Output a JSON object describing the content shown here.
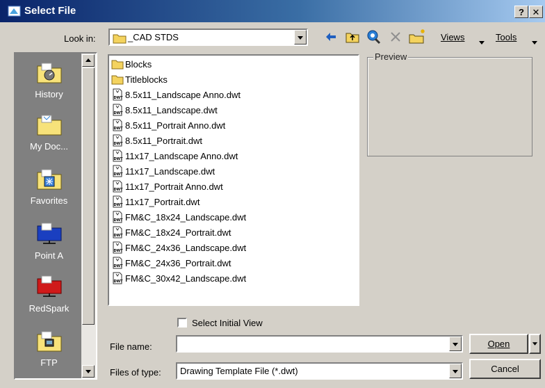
{
  "window": {
    "title": "Select File",
    "help_glyph": "?",
    "close_glyph": "✕"
  },
  "lookin": {
    "label": "Look in:",
    "value": "_CAD STDS"
  },
  "toolbar": {
    "views_label": "Views",
    "tools_label": "Tools"
  },
  "places": [
    {
      "label": "History",
      "icon": "history-folder-icon"
    },
    {
      "label": "My Doc...",
      "icon": "my-documents-folder-icon"
    },
    {
      "label": "Favorites",
      "icon": "favorites-folder-icon"
    },
    {
      "label": "Point A",
      "icon": "network-folder-icon"
    },
    {
      "label": "RedSpark",
      "icon": "network-folder-red-icon"
    },
    {
      "label": "FTP",
      "icon": "ftp-folder-icon"
    }
  ],
  "files": [
    {
      "name": "Blocks",
      "type": "folder"
    },
    {
      "name": "Titleblocks",
      "type": "folder"
    },
    {
      "name": "8.5x11_Landscape Anno.dwt",
      "type": "dwt"
    },
    {
      "name": "8.5x11_Landscape.dwt",
      "type": "dwt"
    },
    {
      "name": "8.5x11_Portrait Anno.dwt",
      "type": "dwt"
    },
    {
      "name": "8.5x11_Portrait.dwt",
      "type": "dwt"
    },
    {
      "name": "11x17_Landscape Anno.dwt",
      "type": "dwt"
    },
    {
      "name": "11x17_Landscape.dwt",
      "type": "dwt"
    },
    {
      "name": "11x17_Portrait Anno.dwt",
      "type": "dwt"
    },
    {
      "name": "11x17_Portrait.dwt",
      "type": "dwt"
    },
    {
      "name": "FM&C_18x24_Landscape.dwt",
      "type": "dwt"
    },
    {
      "name": "FM&C_18x24_Portrait.dwt",
      "type": "dwt"
    },
    {
      "name": "FM&C_24x36_Landscape.dwt",
      "type": "dwt"
    },
    {
      "name": "FM&C_24x36_Portrait.dwt",
      "type": "dwt"
    },
    {
      "name": "FM&C_30x42_Landscape.dwt",
      "type": "dwt"
    }
  ],
  "preview": {
    "label": "Preview"
  },
  "options": {
    "select_initial_view_label": "Select Initial View",
    "select_initial_view_checked": false
  },
  "filename": {
    "label": "File name:",
    "value": ""
  },
  "filetype": {
    "label": "Files of type:",
    "value": "Drawing Template File (*.dwt)"
  },
  "buttons": {
    "open_label": "Open",
    "cancel_label": "Cancel"
  },
  "icon_glyphs": {
    "dwt_label": "DWT"
  },
  "colors": {
    "title_start": "#0a246a",
    "title_end": "#a6caf0",
    "folder": "#f4d35e",
    "dialog_bg": "#d4d0c8"
  }
}
